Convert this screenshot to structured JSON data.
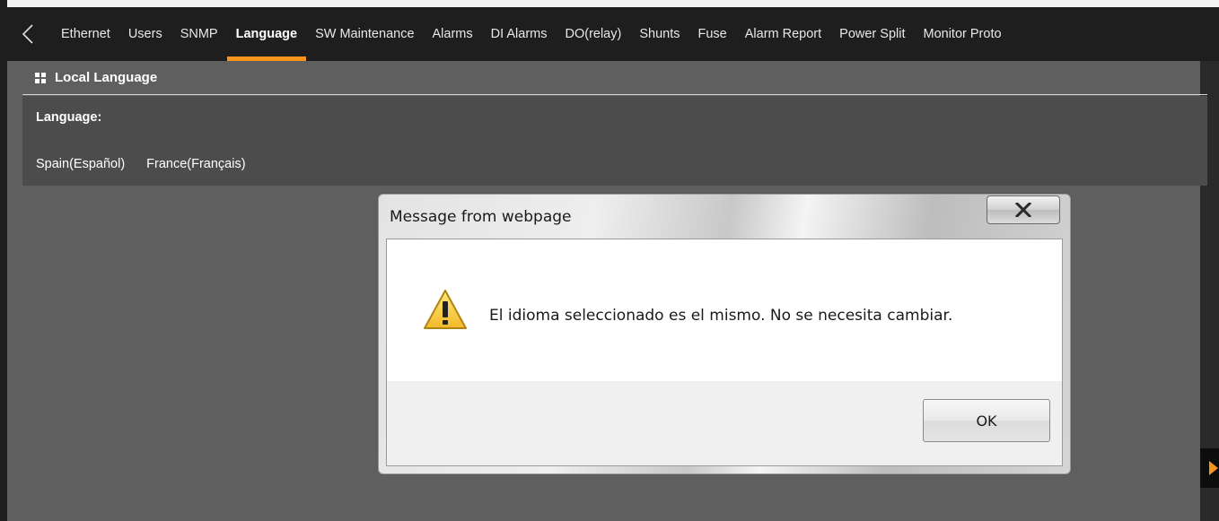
{
  "tabs": [
    {
      "label": "Ethernet",
      "active": false
    },
    {
      "label": "Users",
      "active": false
    },
    {
      "label": "SNMP",
      "active": false
    },
    {
      "label": "Language",
      "active": true
    },
    {
      "label": "SW Maintenance",
      "active": false
    },
    {
      "label": "Alarms",
      "active": false
    },
    {
      "label": "DI Alarms",
      "active": false
    },
    {
      "label": "DO(relay)",
      "active": false
    },
    {
      "label": "Shunts",
      "active": false
    },
    {
      "label": "Fuse",
      "active": false
    },
    {
      "label": "Alarm Report",
      "active": false
    },
    {
      "label": "Power Split",
      "active": false
    },
    {
      "label": "Monitor Proto",
      "active": false
    }
  ],
  "icons": {
    "back": "chevron-left-icon",
    "section": "grid-icon",
    "close": "close-icon",
    "warning": "warning-icon",
    "side_toggle": "caret-right-icon"
  },
  "colors": {
    "accent": "#f7941d",
    "tabbar_bg": "#1e1e1e",
    "page_bg": "#5f5f5f",
    "panel_bg": "#4c4c4c"
  },
  "panel": {
    "title": "Local Language",
    "language_label": "Language:",
    "options": [
      "Spain(Español)",
      "France(Français)"
    ]
  },
  "dialog": {
    "title": "Message from webpage",
    "close_label": "X",
    "message": "El idioma seleccionado es el mismo. No se necesita cambiar.",
    "ok_label": "OK"
  }
}
